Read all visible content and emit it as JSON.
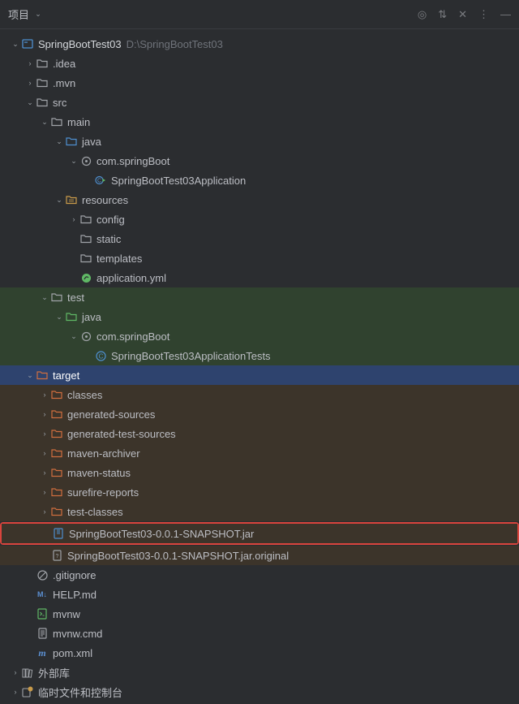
{
  "titlebar": {
    "title": "项目"
  },
  "root": {
    "name": "SpringBootTest03",
    "path": "D:\\SpringBootTest03"
  },
  "nodes": {
    "idea": ".idea",
    "mvn": ".mvn",
    "src": "src",
    "main": "main",
    "java1": "java",
    "pkg1": "com.springBoot",
    "appClass": "SpringBootTest03Application",
    "resources": "resources",
    "config": "config",
    "static": "static",
    "templates": "templates",
    "appYml": "application.yml",
    "test": "test",
    "java2": "java",
    "pkg2": "com.springBoot",
    "testClass": "SpringBootTest03ApplicationTests",
    "target": "target",
    "classes": "classes",
    "genSrc": "generated-sources",
    "genTestSrc": "generated-test-sources",
    "mavenArchiver": "maven-archiver",
    "mavenStatus": "maven-status",
    "surefire": "surefire-reports",
    "testClasses": "test-classes",
    "jar": "SpringBootTest03-0.0.1-SNAPSHOT.jar",
    "jarOrig": "SpringBootTest03-0.0.1-SNAPSHOT.jar.original",
    "gitignore": ".gitignore",
    "help": "HELP.md",
    "mvnw": "mvnw",
    "mvnwCmd": "mvnw.cmd",
    "pom": "pom.xml",
    "extLib": "外部库",
    "scratch": "临时文件和控制台"
  }
}
